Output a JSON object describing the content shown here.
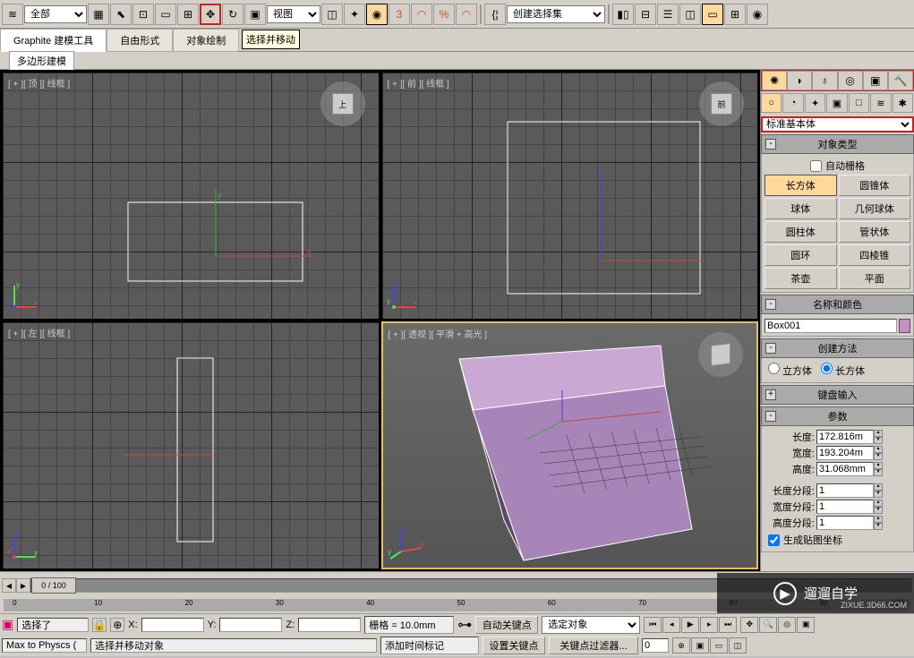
{
  "toolbar": {
    "filter_dropdown": "全部",
    "view_dropdown": "视图",
    "create_set": "创建选择集",
    "tooltip": "选择并移动"
  },
  "ribbon": {
    "tabs": [
      "Graphite 建模工具",
      "自由形式",
      "对象绘制"
    ],
    "sub_tab": "多边形建模"
  },
  "viewports": {
    "top": "[ + ][ 顶 ][ 线框 ]",
    "front": "[ + ][ 前 ][ 线框 ]",
    "left": "[ + ][ 左 ][ 线框 ]",
    "persp": "[ + ][ 透视 ][ 平滑 + 高光 ]",
    "cube_top": "上",
    "cube_front": "前"
  },
  "panel": {
    "geom_dropdown": "标准基本体",
    "rollouts": {
      "obj_type": "对象类型",
      "auto_grid": "自动栅格",
      "types": [
        "长方体",
        "圆锥体",
        "球体",
        "几何球体",
        "圆柱体",
        "管状体",
        "圆环",
        "四棱锥",
        "茶壶",
        "平面"
      ],
      "name_color": "名称和颜色",
      "obj_name": "Box001",
      "create_method": "创建方法",
      "cube_radio": "立方体",
      "box_radio": "长方体",
      "keyboard": "键盘输入",
      "params": "参数",
      "length_lbl": "长度:",
      "length_val": "172.816m",
      "width_lbl": "宽度:",
      "width_val": "193.204m",
      "height_lbl": "高度:",
      "height_val": "31.068mm",
      "lseg_lbl": "长度分段:",
      "lseg_val": "1",
      "wseg_lbl": "宽度分段:",
      "wseg_val": "1",
      "hseg_lbl": "高度分段:",
      "hseg_val": "1",
      "gen_coords": "生成贴图坐标"
    }
  },
  "timeline": {
    "slider_label": "0 / 100"
  },
  "status": {
    "script": "Max to Physcs (",
    "selected": "选择了",
    "selected_hint": "选择并移动对象",
    "x_lbl": "X:",
    "y_lbl": "Y:",
    "z_lbl": "Z:",
    "grid": "栅格 = 10.0mm",
    "add_time": "添加时间标记",
    "auto_key": "自动关键点",
    "set_key": "设置关键点",
    "sel_obj": "选定对象",
    "key_filter": "关键点过滤器..."
  },
  "watermark": {
    "text": "遛遛自学",
    "url": "ZIXUE.3D66.COM"
  }
}
